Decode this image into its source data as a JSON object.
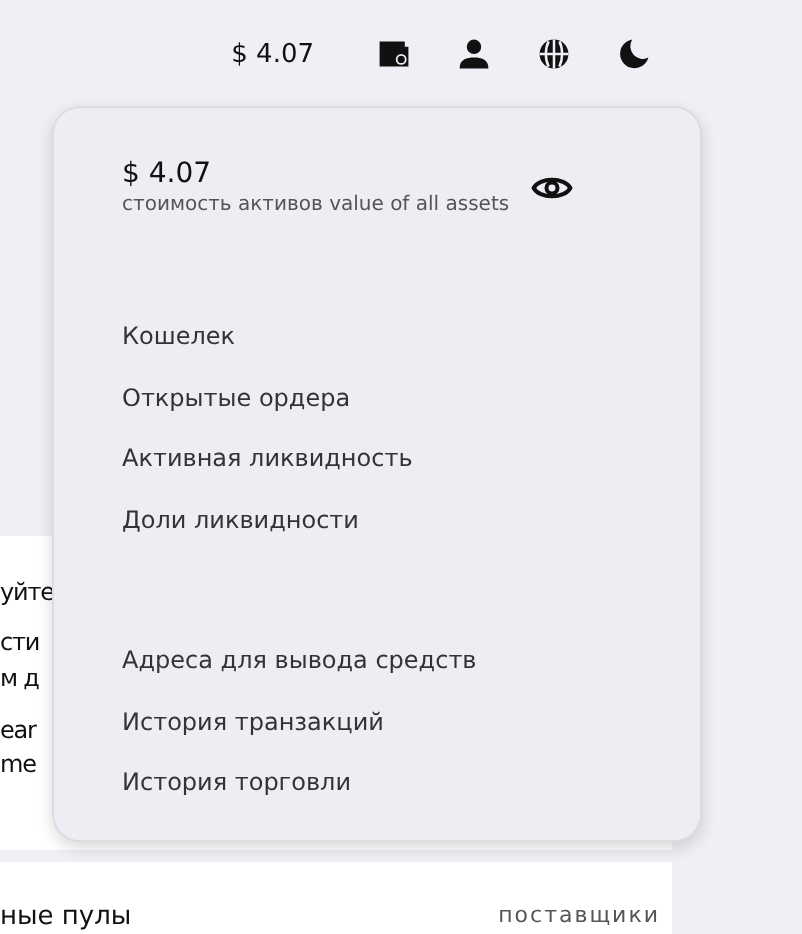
{
  "header": {
    "balance": "$ 4.07"
  },
  "background_card": {
    "lines": [
      "уйте",
      "сти",
      "м д",
      "ear",
      "me"
    ]
  },
  "pools_panel": {
    "title": "ные пулы",
    "column": "поставщики"
  },
  "account_menu": {
    "value": "$ 4.07",
    "caption": "стоимость активов value of all assets",
    "groups": [
      [
        "Кошелек",
        "Открытые ордера",
        "Активная ликвидность",
        "Доли ликвидности"
      ],
      [
        "Адреса для вывода средств",
        "История транзакций",
        "История торговли"
      ]
    ]
  }
}
